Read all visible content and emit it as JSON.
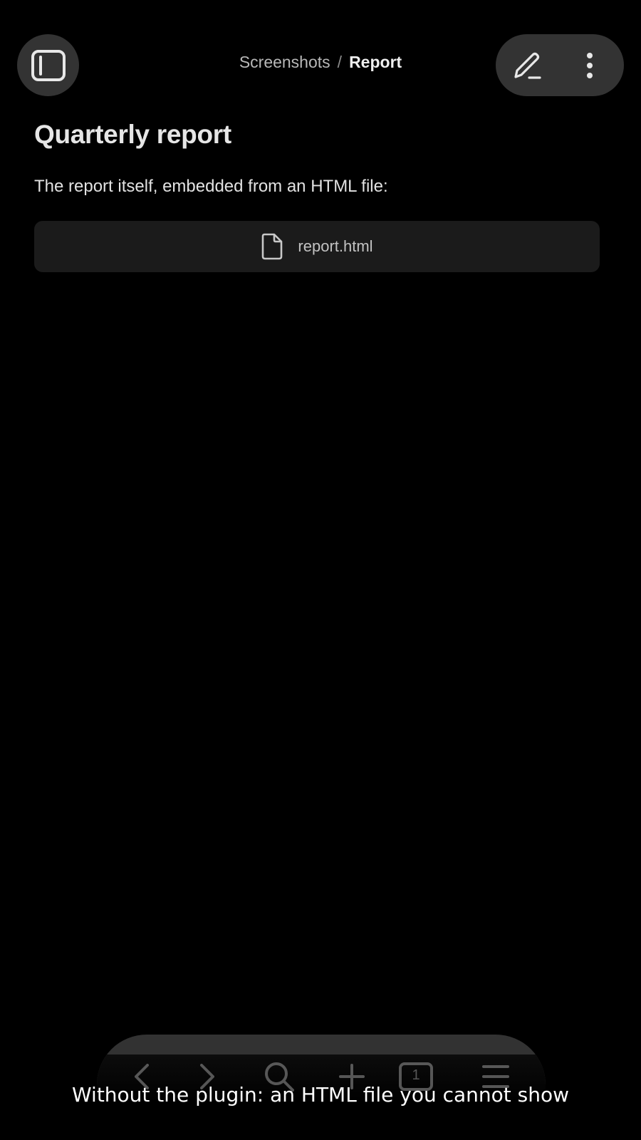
{
  "header": {
    "sidebar_toggle_icon": "sidebar-toggle-icon",
    "breadcrumb": {
      "parent": "Screenshots",
      "separator": "/",
      "current": "Report"
    },
    "actions": {
      "edit_icon": "pencil-icon",
      "more_icon": "more-vertical-icon"
    }
  },
  "main": {
    "title": "Quarterly report",
    "intro": "The report itself, embedded from an HTML file:",
    "embed": {
      "icon": "file-icon",
      "filename": "report.html"
    }
  },
  "bottom_toolbar": {
    "icons": [
      "back-icon",
      "forward-icon",
      "search-icon",
      "plus-icon",
      "tabs-icon",
      "menu-icon"
    ],
    "tab_count": "1"
  },
  "caption": "Without the plugin: an HTML file you cannot show",
  "colors": {
    "background": "#000000",
    "button_surface": "#333333",
    "embed_surface": "#1b1b1b",
    "text_primary": "#e6e6e6",
    "text_muted": "#b8b8b8"
  }
}
